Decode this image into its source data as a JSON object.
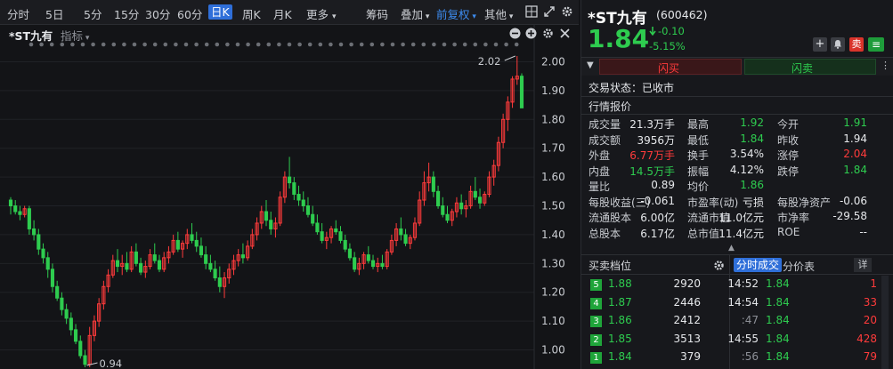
{
  "toolbar": {
    "periods": [
      "分时",
      "5日",
      "5分",
      "15分",
      "30分",
      "60分",
      "日K",
      "周K",
      "月K",
      "更多"
    ],
    "active_period": "日K",
    "more_caret": "▾",
    "draw_label": "筹码",
    "overlay_label": "叠加",
    "adjust_label": "前复权",
    "other_label": "其他"
  },
  "chart_head": {
    "stock_label": "*ST九有",
    "indicator_label": "指标"
  },
  "chart_data": {
    "type": "candlestick",
    "y_ticks": [
      "2.00",
      "1.90",
      "1.80",
      "1.70",
      "1.60",
      "1.50",
      "1.40",
      "1.30",
      "1.20",
      "1.10",
      "1.00"
    ],
    "ylim": [
      0.94,
      2.02
    ],
    "max_label": "2.02",
    "min_label": "0.94",
    "colors": {
      "up": "#ff3b3b",
      "down": "#2ecc4f"
    },
    "ohlc": [
      [
        1.52,
        1.53,
        1.47,
        1.5
      ],
      [
        1.5,
        1.52,
        1.47,
        1.48
      ],
      [
        1.48,
        1.5,
        1.45,
        1.47
      ],
      [
        1.47,
        1.5,
        1.46,
        1.49
      ],
      [
        1.49,
        1.5,
        1.4,
        1.42
      ],
      [
        1.42,
        1.45,
        1.38,
        1.4
      ],
      [
        1.4,
        1.42,
        1.33,
        1.35
      ],
      [
        1.35,
        1.37,
        1.3,
        1.32
      ],
      [
        1.32,
        1.34,
        1.25,
        1.28
      ],
      [
        1.28,
        1.3,
        1.2,
        1.22
      ],
      [
        1.22,
        1.24,
        1.17,
        1.18
      ],
      [
        1.18,
        1.2,
        1.12,
        1.14
      ],
      [
        1.14,
        1.16,
        1.09,
        1.11
      ],
      [
        1.11,
        1.13,
        1.05,
        1.07
      ],
      [
        1.07,
        1.09,
        1.02,
        1.03
      ],
      [
        1.03,
        1.05,
        0.97,
        0.98
      ],
      [
        0.98,
        1.0,
        0.94,
        0.95
      ],
      [
        0.95,
        1.08,
        0.94,
        1.05
      ],
      [
        1.05,
        1.12,
        1.03,
        1.1
      ],
      [
        1.1,
        1.18,
        1.08,
        1.16
      ],
      [
        1.16,
        1.24,
        1.14,
        1.22
      ],
      [
        1.22,
        1.28,
        1.2,
        1.26
      ],
      [
        1.26,
        1.33,
        1.25,
        1.31
      ],
      [
        1.31,
        1.35,
        1.27,
        1.29
      ],
      [
        1.29,
        1.33,
        1.26,
        1.3
      ],
      [
        1.3,
        1.34,
        1.27,
        1.28
      ],
      [
        1.28,
        1.36,
        1.27,
        1.34
      ],
      [
        1.34,
        1.37,
        1.29,
        1.3
      ],
      [
        1.3,
        1.32,
        1.26,
        1.27
      ],
      [
        1.27,
        1.31,
        1.25,
        1.29
      ],
      [
        1.29,
        1.35,
        1.28,
        1.33
      ],
      [
        1.33,
        1.37,
        1.3,
        1.31
      ],
      [
        1.31,
        1.33,
        1.27,
        1.28
      ],
      [
        1.28,
        1.34,
        1.27,
        1.32
      ],
      [
        1.32,
        1.36,
        1.3,
        1.34
      ],
      [
        1.34,
        1.4,
        1.33,
        1.38
      ],
      [
        1.38,
        1.41,
        1.34,
        1.35
      ],
      [
        1.35,
        1.38,
        1.32,
        1.37
      ],
      [
        1.37,
        1.42,
        1.35,
        1.4
      ],
      [
        1.4,
        1.44,
        1.37,
        1.38
      ],
      [
        1.38,
        1.41,
        1.34,
        1.36
      ],
      [
        1.36,
        1.39,
        1.32,
        1.33
      ],
      [
        1.33,
        1.36,
        1.28,
        1.3
      ],
      [
        1.3,
        1.33,
        1.27,
        1.28
      ],
      [
        1.28,
        1.31,
        1.24,
        1.25
      ],
      [
        1.25,
        1.29,
        1.2,
        1.22
      ],
      [
        1.22,
        1.27,
        1.18,
        1.25
      ],
      [
        1.25,
        1.3,
        1.23,
        1.28
      ],
      [
        1.28,
        1.33,
        1.26,
        1.31
      ],
      [
        1.31,
        1.35,
        1.29,
        1.33
      ],
      [
        1.33,
        1.37,
        1.3,
        1.32
      ],
      [
        1.32,
        1.38,
        1.31,
        1.36
      ],
      [
        1.36,
        1.42,
        1.35,
        1.4
      ],
      [
        1.4,
        1.46,
        1.38,
        1.44
      ],
      [
        1.44,
        1.5,
        1.42,
        1.48
      ],
      [
        1.48,
        1.52,
        1.43,
        1.45
      ],
      [
        1.45,
        1.48,
        1.4,
        1.42
      ],
      [
        1.42,
        1.46,
        1.39,
        1.44
      ],
      [
        1.44,
        1.55,
        1.43,
        1.53
      ],
      [
        1.53,
        1.62,
        1.51,
        1.6
      ],
      [
        1.6,
        1.67,
        1.56,
        1.58
      ],
      [
        1.58,
        1.6,
        1.52,
        1.54
      ],
      [
        1.54,
        1.57,
        1.5,
        1.52
      ],
      [
        1.52,
        1.55,
        1.48,
        1.5
      ],
      [
        1.5,
        1.53,
        1.46,
        1.47
      ],
      [
        1.47,
        1.5,
        1.43,
        1.44
      ],
      [
        1.44,
        1.47,
        1.4,
        1.41
      ],
      [
        1.41,
        1.44,
        1.37,
        1.38
      ],
      [
        1.38,
        1.41,
        1.35,
        1.39
      ],
      [
        1.39,
        1.43,
        1.37,
        1.42
      ],
      [
        1.42,
        1.45,
        1.4,
        1.41
      ],
      [
        1.41,
        1.43,
        1.37,
        1.38
      ],
      [
        1.38,
        1.4,
        1.34,
        1.35
      ],
      [
        1.35,
        1.37,
        1.31,
        1.32
      ],
      [
        1.32,
        1.34,
        1.27,
        1.28
      ],
      [
        1.28,
        1.32,
        1.26,
        1.3
      ],
      [
        1.3,
        1.34,
        1.28,
        1.33
      ],
      [
        1.33,
        1.36,
        1.3,
        1.31
      ],
      [
        1.31,
        1.33,
        1.28,
        1.29
      ],
      [
        1.29,
        1.32,
        1.27,
        1.3
      ],
      [
        1.3,
        1.33,
        1.28,
        1.29
      ],
      [
        1.29,
        1.35,
        1.28,
        1.34
      ],
      [
        1.34,
        1.4,
        1.33,
        1.38
      ],
      [
        1.38,
        1.44,
        1.36,
        1.42
      ],
      [
        1.42,
        1.46,
        1.38,
        1.4
      ],
      [
        1.4,
        1.42,
        1.36,
        1.37
      ],
      [
        1.37,
        1.4,
        1.35,
        1.39
      ],
      [
        1.39,
        1.46,
        1.38,
        1.44
      ],
      [
        1.44,
        1.55,
        1.43,
        1.52
      ],
      [
        1.52,
        1.62,
        1.5,
        1.58
      ],
      [
        1.58,
        1.65,
        1.55,
        1.6
      ],
      [
        1.6,
        1.62,
        1.53,
        1.55
      ],
      [
        1.55,
        1.57,
        1.49,
        1.5
      ],
      [
        1.5,
        1.53,
        1.46,
        1.47
      ],
      [
        1.47,
        1.5,
        1.44,
        1.45
      ],
      [
        1.45,
        1.49,
        1.43,
        1.48
      ],
      [
        1.48,
        1.53,
        1.46,
        1.51
      ],
      [
        1.51,
        1.54,
        1.47,
        1.49
      ],
      [
        1.49,
        1.52,
        1.46,
        1.5
      ],
      [
        1.5,
        1.57,
        1.49,
        1.55
      ],
      [
        1.55,
        1.6,
        1.52,
        1.53
      ],
      [
        1.53,
        1.56,
        1.49,
        1.51
      ],
      [
        1.51,
        1.55,
        1.5,
        1.54
      ],
      [
        1.54,
        1.62,
        1.53,
        1.6
      ],
      [
        1.6,
        1.66,
        1.57,
        1.64
      ],
      [
        1.64,
        1.74,
        1.62,
        1.72
      ],
      [
        1.72,
        1.82,
        1.7,
        1.8
      ],
      [
        1.8,
        1.88,
        1.76,
        1.86
      ],
      [
        1.86,
        1.95,
        1.84,
        1.94
      ],
      [
        1.94,
        2.02,
        1.92,
        1.95
      ],
      [
        1.95,
        1.96,
        1.84,
        1.84
      ]
    ],
    "event_dot_count": 48
  },
  "quote": {
    "name": "*ST九有",
    "code": "(600462)",
    "price": "1.84",
    "change": "-0.10",
    "change_pct": "-5.15%",
    "buttons": {
      "add": "+",
      "bell": "🔔",
      "sell_badge": "卖",
      "menu": "≡"
    },
    "flash_buy": "闪买",
    "flash_sell": "闪卖",
    "trade_status": "交易状态：已收市"
  },
  "market": {
    "title": "行情报价",
    "rows": [
      [
        {
          "l": "成交量",
          "v": "21.3万手",
          "c": "white"
        },
        {
          "l": "最高",
          "v": "1.92",
          "c": "green"
        },
        {
          "l": "今开",
          "v": "1.91",
          "c": "green"
        }
      ],
      [
        {
          "l": "成交额",
          "v": "3956万",
          "c": "white"
        },
        {
          "l": "最低",
          "v": "1.84",
          "c": "green"
        },
        {
          "l": "昨收",
          "v": "1.94",
          "c": "white"
        }
      ],
      [
        {
          "l": "外盘",
          "v": "6.77万手",
          "c": "red"
        },
        {
          "l": "换手",
          "v": "3.54%",
          "c": "white"
        },
        {
          "l": "涨停",
          "v": "2.04",
          "c": "red"
        }
      ],
      [
        {
          "l": "内盘",
          "v": "14.5万手",
          "c": "green"
        },
        {
          "l": "振幅",
          "v": "4.12%",
          "c": "white"
        },
        {
          "l": "跌停",
          "v": "1.84",
          "c": "green"
        }
      ],
      [
        {
          "l": "量比",
          "v": "0.89",
          "c": "white"
        },
        {
          "l": "均价",
          "v": "1.86",
          "c": "green"
        },
        {
          "l": "",
          "v": "",
          "c": "white"
        }
      ],
      [
        {
          "l": "每股收益(三)",
          "v": "-0.061",
          "c": "white"
        },
        {
          "l": "市盈率(动)",
          "v": "亏损",
          "c": "white"
        },
        {
          "l": "每股净资产",
          "v": "-0.06",
          "c": "white"
        }
      ],
      [
        {
          "l": "流通股本",
          "v": "6.00亿",
          "c": "white"
        },
        {
          "l": "流通市值",
          "v": "11.0亿元",
          "c": "white"
        },
        {
          "l": "市净率",
          "v": "-29.58",
          "c": "white"
        }
      ],
      [
        {
          "l": "总股本",
          "v": "6.17亿",
          "c": "white"
        },
        {
          "l": "总市值",
          "v": "11.4亿元",
          "c": "white"
        },
        {
          "l": "ROE",
          "v": "--",
          "c": "white"
        }
      ]
    ]
  },
  "orderbook": {
    "title": "买卖档位",
    "levels": [
      {
        "n": "5",
        "p": "1.88",
        "v": "2920"
      },
      {
        "n": "4",
        "p": "1.87",
        "v": "2446"
      },
      {
        "n": "3",
        "p": "1.86",
        "v": "2412"
      },
      {
        "n": "2",
        "p": "1.85",
        "v": "3513"
      },
      {
        "n": "1",
        "p": "1.84",
        "v": "379"
      }
    ]
  },
  "ticks": {
    "tab_active": "分时成交",
    "tab_other": "分价表",
    "detail": "详",
    "rows": [
      {
        "t": "14:52",
        "p": "1.84",
        "v": "1"
      },
      {
        "t": "14:54",
        "p": "1.84",
        "v": "33"
      },
      {
        "t": ":47",
        "p": "1.84",
        "v": "20"
      },
      {
        "t": "14:55",
        "p": "1.84",
        "v": "428"
      },
      {
        "t": ":56",
        "p": "1.84",
        "v": "79"
      }
    ]
  }
}
